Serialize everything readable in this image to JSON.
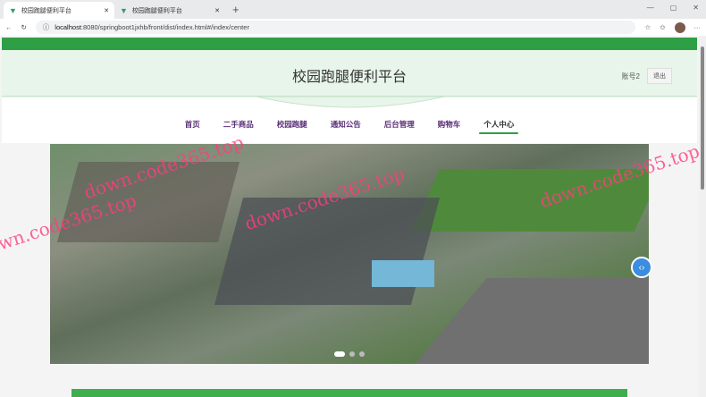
{
  "browser": {
    "tabs": [
      {
        "label": "校园跑腿便利平台",
        "active": true
      },
      {
        "label": "校园跑腿便利平台",
        "active": false
      }
    ],
    "url_host": "localhost",
    "url_rest": ":8080/springboot1jxhb/front/dist/index.html#/index/center"
  },
  "header": {
    "title": "校园跑腿便利平台",
    "account": "账号2",
    "logout": "退出"
  },
  "nav": [
    {
      "label": "首页"
    },
    {
      "label": "二手商品"
    },
    {
      "label": "校园跑腿"
    },
    {
      "label": "通知公告"
    },
    {
      "label": "后台管理"
    },
    {
      "label": "购物车"
    },
    {
      "label": "个人中心",
      "active": true
    }
  ],
  "watermark": "down.code365.top",
  "colors": {
    "primary": "#2f9f45",
    "nav_text": "#5b2f78",
    "header_bg": "#e8f5ea"
  }
}
